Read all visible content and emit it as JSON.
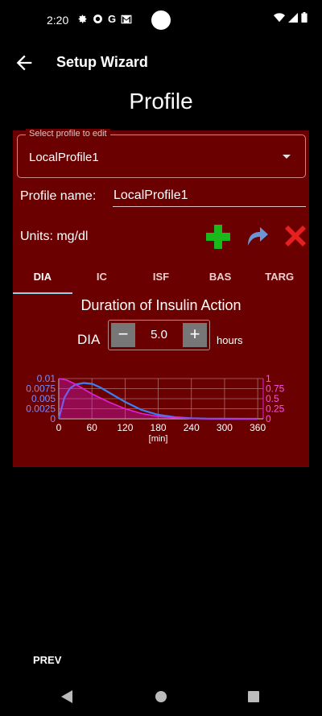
{
  "status_bar": {
    "time": "2:20",
    "icons": [
      "gear-icon",
      "vpn-icon",
      "G",
      "gmail-icon"
    ]
  },
  "app_bar": {
    "title": "Setup Wizard"
  },
  "page_title": "Profile",
  "profile_select": {
    "legend": "Select profile to edit",
    "value": "LocalProfile1"
  },
  "profile_name": {
    "label": "Profile name:",
    "value": "LocalProfile1"
  },
  "units_label": "Units: mg/dl",
  "tabs": [
    {
      "label": "DIA",
      "active": true
    },
    {
      "label": "IC",
      "active": false
    },
    {
      "label": "ISF",
      "active": false
    },
    {
      "label": "BAS",
      "active": false
    },
    {
      "label": "TARG",
      "active": false
    }
  ],
  "dia": {
    "title": "Duration of Insulin Action",
    "label": "DIA",
    "value": "5.0",
    "unit": "hours",
    "minus": "−",
    "plus": "+"
  },
  "chart_data": {
    "type": "line",
    "x_ticks": [
      "0",
      "60",
      "120",
      "180",
      "240",
      "300",
      "360"
    ],
    "xlabel": "[min]",
    "xlim": [
      0,
      370
    ],
    "y_left_ticks": [
      "0.01",
      "0.0075",
      "0.005",
      "0.0025",
      "0"
    ],
    "ylim_left": [
      0,
      0.01
    ],
    "y_right_ticks": [
      "1",
      "0.75",
      "0.5",
      "0.25",
      "0"
    ],
    "ylim_right": [
      0,
      1
    ],
    "series": [
      {
        "axis": "left",
        "color": "#3b7ff5",
        "x": [
          0,
          10,
          20,
          30,
          45,
          60,
          75,
          90,
          120,
          150,
          180,
          210,
          240,
          270,
          300,
          330,
          360
        ],
        "y": [
          0,
          0.0052,
          0.0075,
          0.0085,
          0.0089,
          0.0087,
          0.0078,
          0.0066,
          0.0042,
          0.0022,
          0.001,
          0.0004,
          0.00015,
          5e-05,
          2e-05,
          1e-05,
          0
        ]
      },
      {
        "axis": "right",
        "color": "#e020e0",
        "fill": true,
        "x": [
          0,
          15,
          30,
          45,
          60,
          90,
          120,
          150,
          180,
          210,
          240,
          270,
          300,
          330,
          360
        ],
        "y": [
          1,
          0.96,
          0.86,
          0.74,
          0.62,
          0.42,
          0.25,
          0.13,
          0.06,
          0.025,
          0.01,
          0.004,
          0.002,
          0.001,
          0
        ]
      }
    ]
  },
  "prev_label": "PREV",
  "colors": {
    "panel": "#6b0000",
    "plus_green": "#1bb81b",
    "redo_blue": "#6b96d6",
    "delete_red": "#e62020"
  }
}
